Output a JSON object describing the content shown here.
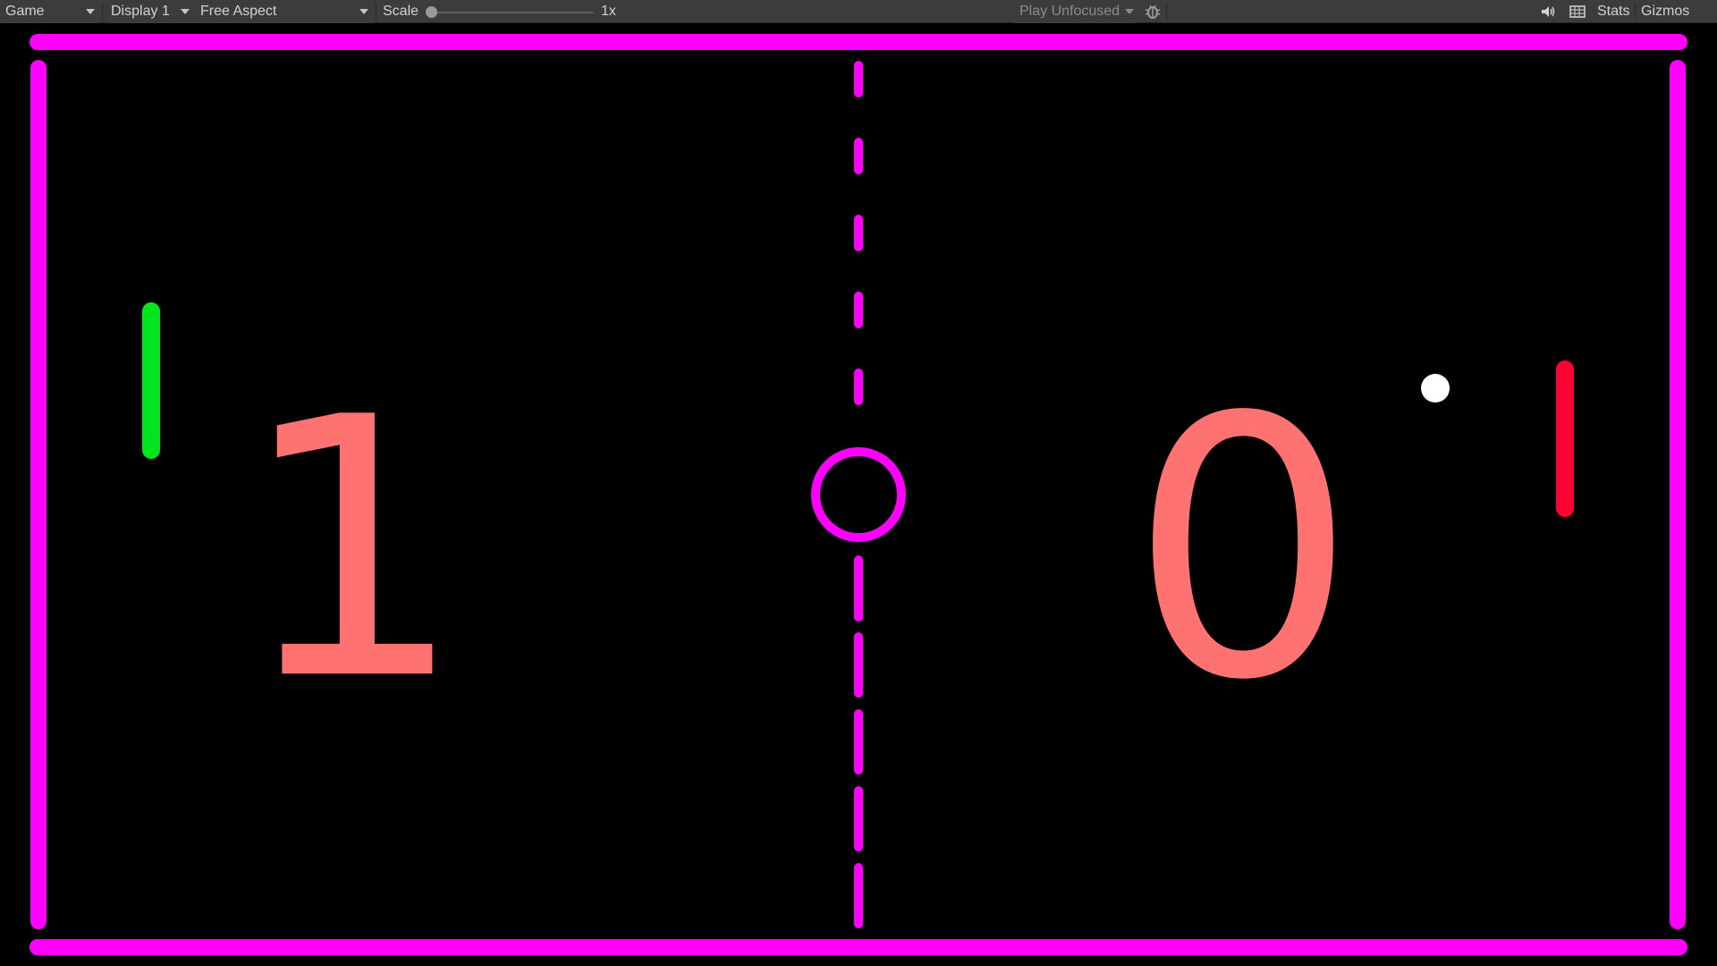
{
  "toolbar": {
    "view_tab": "Game",
    "display": "Display 1",
    "aspect": "Free Aspect",
    "scale_label": "Scale",
    "scale_value": "1x",
    "scale_slider_level": 0,
    "play_mode": "Play Unfocused",
    "stats_label": "Stats",
    "gizmos_label": "Gizmos",
    "icons": {
      "audio": "speaker-icon",
      "debug": "bug-icon",
      "grid": "grid-icon"
    }
  },
  "game": {
    "score_left": "1",
    "score_right": "0",
    "colors": {
      "background": "#000000",
      "walls": "#ff00ff",
      "center_line": "#ff00ff",
      "score": "#ff7272",
      "left_paddle": "#00e61e",
      "right_paddle": "#ff0033",
      "ball": "#ffffff"
    }
  }
}
